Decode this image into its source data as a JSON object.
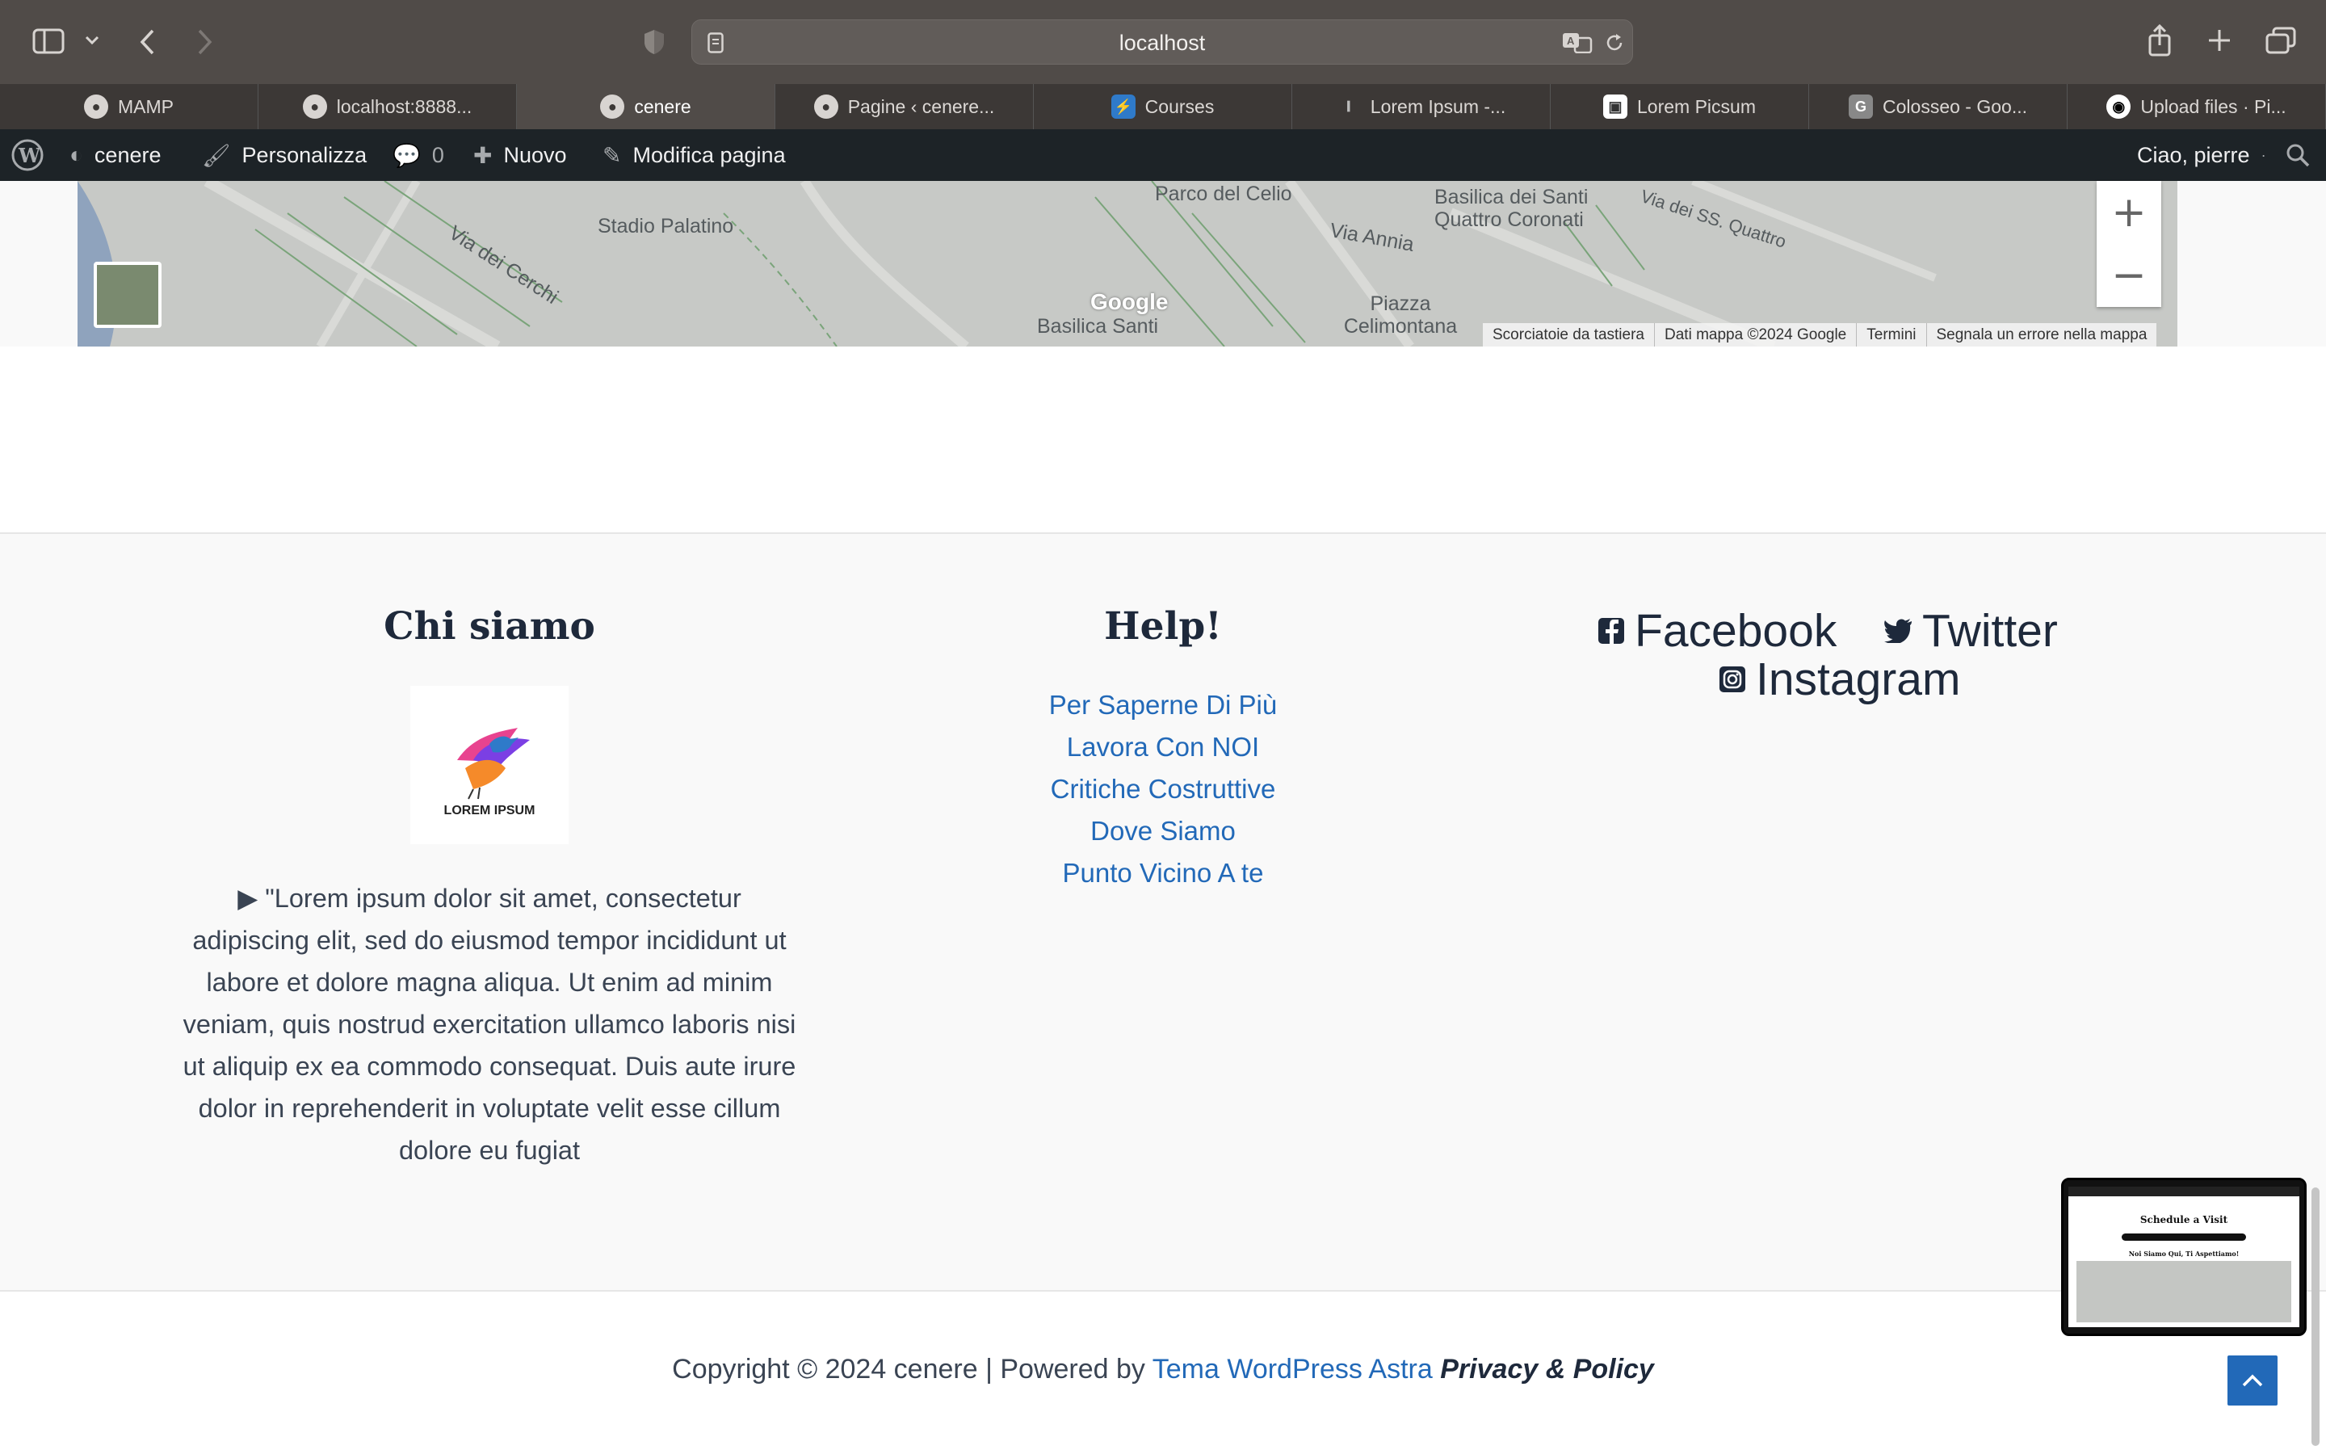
{
  "browser": {
    "url": "localhost",
    "tabs": [
      {
        "label": "MAMP",
        "icon": "mamp-elephant-icon"
      },
      {
        "label": "localhost:8888...",
        "icon": "mamp-elephant-icon"
      },
      {
        "label": "cenere",
        "icon": "mamp-elephant-icon",
        "active": true
      },
      {
        "label": "Pagine ‹ cenere...",
        "icon": "mamp-elephant-icon"
      },
      {
        "label": "Courses",
        "icon": "courses-icon"
      },
      {
        "label": "Lorem Ipsum -...",
        "icon": "lorem-ipsum-icon"
      },
      {
        "label": "Lorem Picsum",
        "icon": "picsum-icon"
      },
      {
        "label": "Colosseo - Goo...",
        "icon": "g-icon"
      },
      {
        "label": "Upload files · Pi...",
        "icon": "github-icon"
      }
    ]
  },
  "adminbar": {
    "site_name": "cenere",
    "customize": "Personalizza",
    "comments_count": "0",
    "new": "Nuovo",
    "edit_page": "Modifica pagina",
    "greeting": "Ciao, pierre"
  },
  "map": {
    "labels": [
      "Via dei Cerchi",
      "Stadio Palatino",
      "Parco del Celio",
      "Basilica dei Santi Quattro Coronati",
      "Via Annia",
      "Via dei SS. Quattro",
      "Piazza Celimontana",
      "Basilica Santi"
    ],
    "attribution": [
      "Scorciatoie da tastiera",
      "Dati mappa ©2024 Google",
      "Termini",
      "Segnala un errore nella mappa"
    ],
    "google_logo": "Google"
  },
  "footer": {
    "about": {
      "title": "Chi siamo",
      "logo_text": "LOREM IPSUM",
      "text": "▶ \"Lorem ipsum dolor sit amet, consectetur adipiscing elit, sed do eiusmod tempor incididunt ut labore et dolore magna aliqua. Ut enim ad minim veniam, quis nostrud exercitation ullamco laboris nisi ut aliquip ex ea commodo consequat. Duis aute irure dolor in reprehenderit in voluptate velit esse cillum dolore eu fugiat"
    },
    "help": {
      "title": "Help!",
      "links": [
        "Per Saperne Di Più",
        "Lavora Con NOI",
        "Critiche Costruttive",
        "Dove Siamo",
        "Punto Vicino A te"
      ]
    },
    "social": {
      "facebook": "Facebook",
      "twitter": "Twitter",
      "instagram": "Instagram"
    },
    "copyright": {
      "prefix": "Copyright © 2024 cenere | Powered by ",
      "theme_link": "Tema WordPress Astra",
      "policy": "Privacy & Policy"
    }
  },
  "pip_preview": {
    "title": "Schedule a Visit",
    "subtitle": "Noi Siamo Qui, Ti Aspettiamo!"
  },
  "colors": {
    "link": "#2269b8",
    "adminbar": "#1d2327",
    "toolbar": "#504b48"
  }
}
